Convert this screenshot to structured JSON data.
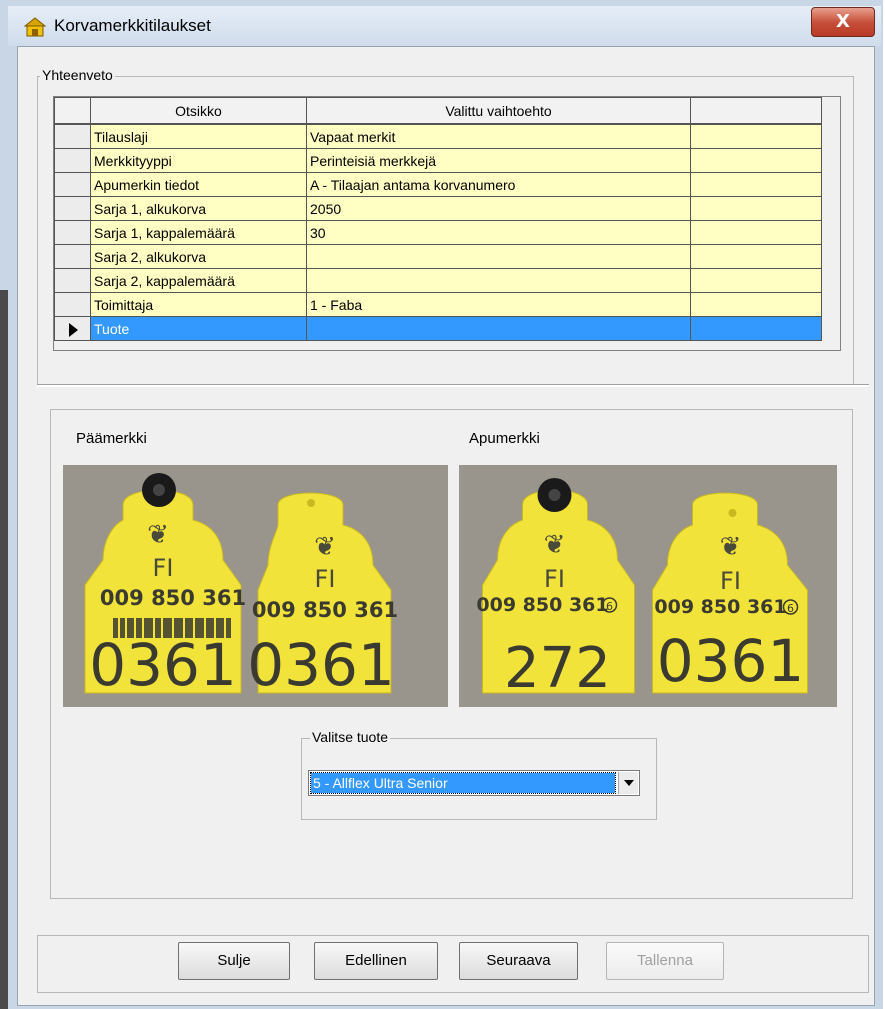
{
  "window": {
    "title": "Korvamerkkitilaukset",
    "close_symbol": "X"
  },
  "summary": {
    "group_label": "Yhteenveto",
    "columns": [
      "Otsikko",
      "Valittu vaihtoehto",
      ""
    ],
    "rows": [
      {
        "title": "Tilauslaji",
        "value": "Vapaat merkit",
        "selected": false
      },
      {
        "title": "Merkkityyppi",
        "value": "Perinteisiä merkkejä",
        "selected": false
      },
      {
        "title": "Apumerkin tiedot",
        "value": "A - Tilaajan antama korvanumero",
        "selected": false
      },
      {
        "title": "Sarja 1, alkukorva",
        "value": "2050",
        "selected": false
      },
      {
        "title": "Sarja 1, kappalemäärä",
        "value": "30",
        "selected": false
      },
      {
        "title": "Sarja 2, alkukorva",
        "value": "",
        "selected": false
      },
      {
        "title": "Sarja 2, kappalemäärä",
        "value": "",
        "selected": false
      },
      {
        "title": "Toimittaja",
        "value": "1 - Faba",
        "selected": false
      },
      {
        "title": "Tuote",
        "value": "",
        "selected": true
      }
    ]
  },
  "product": {
    "main_label": "Päämerkki",
    "helper_label": "Apumerkki",
    "main_tags": [
      {
        "country": "FI",
        "number": "009 850 361",
        "big": "0361"
      },
      {
        "country": "FI",
        "number": "009 850 361",
        "big": "0361"
      }
    ],
    "helper_tags": [
      {
        "country": "FI",
        "number": "009 850 361",
        "big": "272"
      },
      {
        "country": "FI",
        "number": "009 850 361",
        "big": "0361"
      }
    ],
    "tag_circle_mark": "6",
    "select_group_label": "Valitse tuote",
    "selected_product": "5 - Allflex Ultra Senior"
  },
  "buttons": {
    "close": "Sulje",
    "previous": "Edellinen",
    "next": "Seuraava",
    "save": "Tallenna"
  },
  "colors": {
    "grid_cell": "#ffffc4",
    "selection": "#3399ff",
    "tag_yellow": "#f2e33a",
    "close_button": "#c7513c"
  }
}
